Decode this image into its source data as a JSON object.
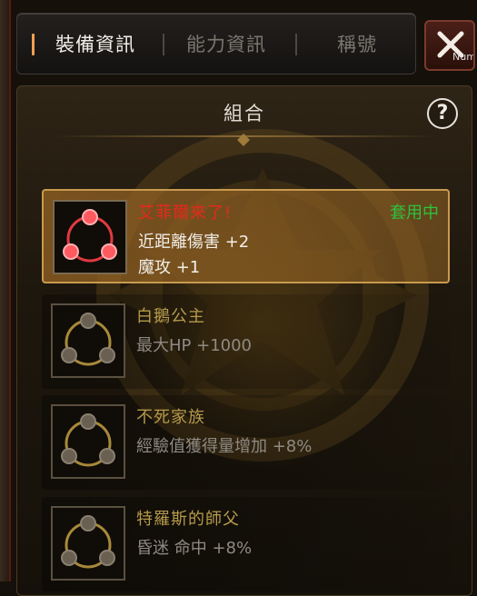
{
  "tabs": [
    {
      "label": "裝備資訊",
      "active": true
    },
    {
      "label": "能力資訊",
      "active": false
    },
    {
      "label": "稱號",
      "active": false
    }
  ],
  "close_button": {
    "icon": "close-icon",
    "overflow_text": "Num"
  },
  "panel": {
    "title": "組合",
    "help_icon": "question-icon",
    "help_label": "?"
  },
  "sets": [
    {
      "name": "艾菲爾來了!",
      "status": "套用中",
      "effects": [
        "近距離傷害 +2",
        "魔攻 +1"
      ],
      "active": true
    },
    {
      "name": "白鵝公主",
      "status": "",
      "effects": [
        "最大HP +1000"
      ],
      "active": false
    },
    {
      "name": "不死家族",
      "status": "",
      "effects": [
        "經驗值獲得量增加 +8%"
      ],
      "active": false
    },
    {
      "name": "特羅斯的師父",
      "status": "",
      "effects": [
        "昏迷 命中 +8%"
      ],
      "active": false
    }
  ],
  "colors": {
    "active_name": "#e8281c",
    "inactive_name": "#b59a4c",
    "status": "#2cc23c",
    "tab_marker": "#f0a050"
  }
}
